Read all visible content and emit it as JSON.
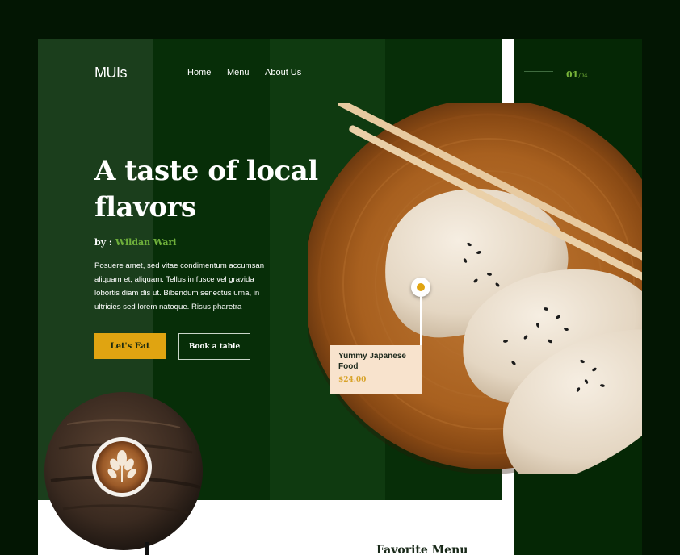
{
  "brand": {
    "logo": "MUIs"
  },
  "nav": {
    "home": "Home",
    "menu": "Menu",
    "about": "About Us"
  },
  "slider": {
    "current": "01",
    "total": "/04"
  },
  "hero": {
    "title": "A taste of local flavors",
    "author_prefix": "by : ",
    "author_name": "Wildan Wari",
    "description": "Posuere amet, sed vitae condimentum accumsan aliquam et, aliquam. Tellus in fusce vel gravida lobortis diam dis ut. Bibendum senectus urna, in ultricies sed lorem natoque. Risus pharetra",
    "primary_button": "Let's Eat",
    "secondary_button": "Book a table"
  },
  "featured_item": {
    "name": "Yummy Japanese Food",
    "price": "$24.00"
  },
  "section": {
    "favorite_title": "Favorite Menu"
  },
  "colors": {
    "background": "#031603",
    "card_green": "#072e08",
    "accent_yellow": "#e0a411",
    "accent_green": "#6fb03b",
    "price_gold": "#d8a32a",
    "tag_bg": "#f8e3cd"
  },
  "images": {
    "plate": "dumplings-plate-with-chopsticks",
    "coffee": "latte-on-rustic-wooden-table"
  }
}
